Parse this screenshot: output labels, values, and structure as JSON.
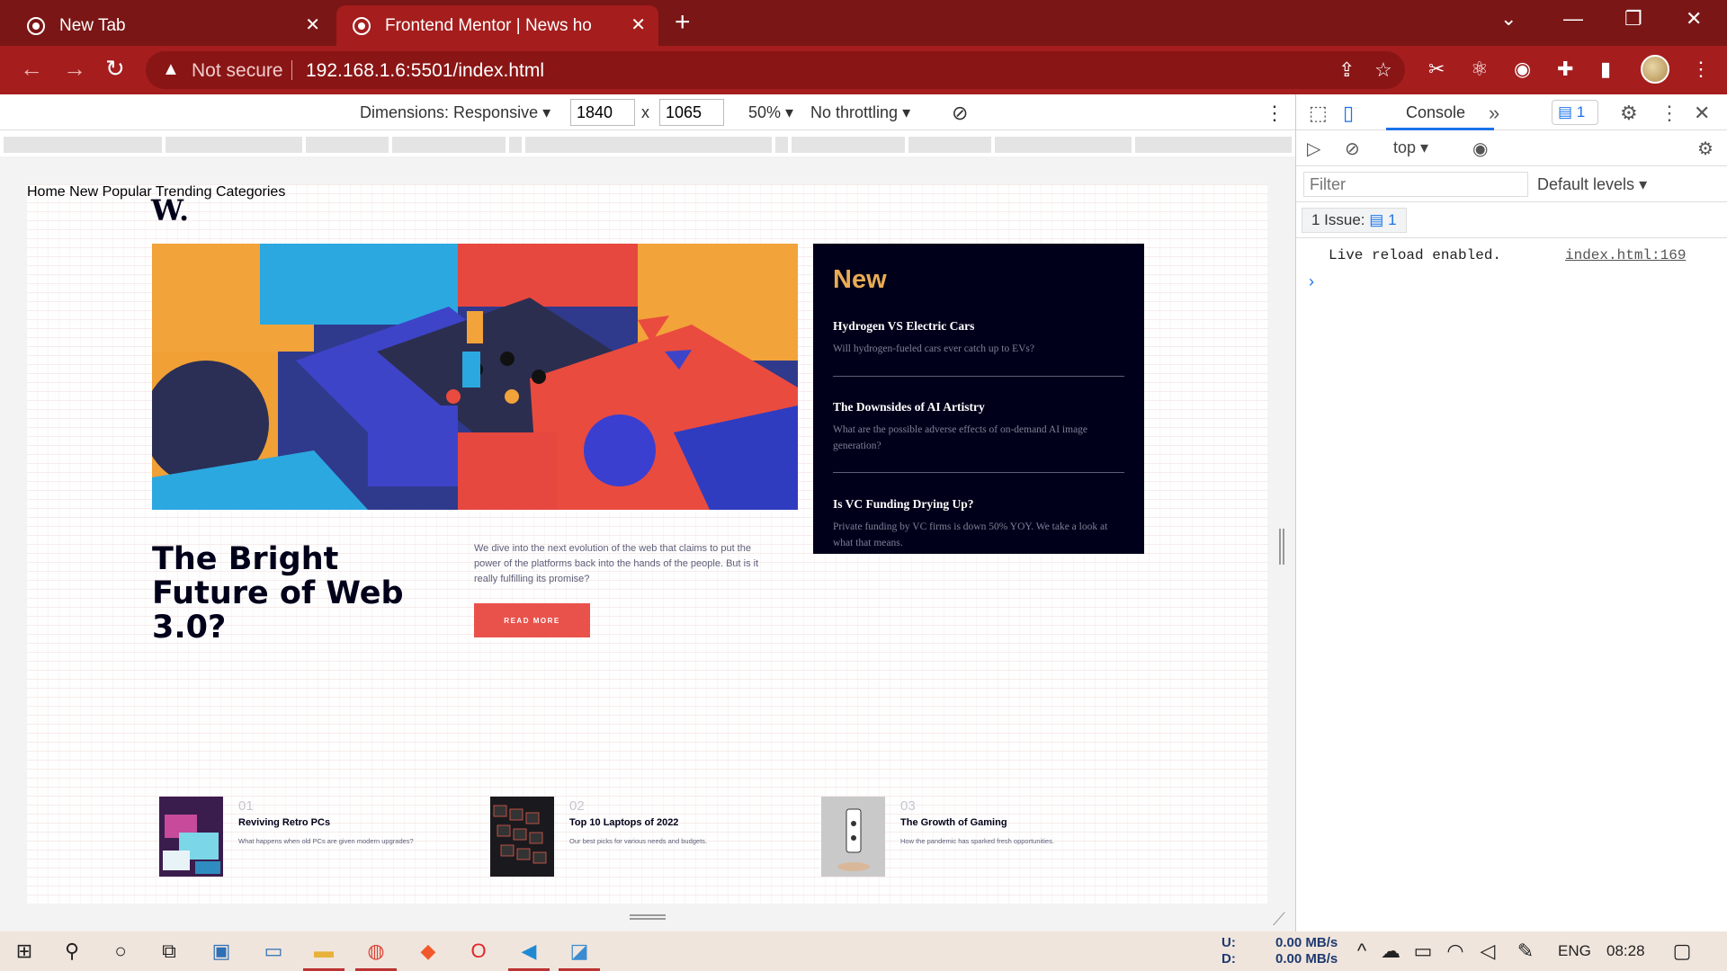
{
  "browser": {
    "tabs": [
      {
        "title": "New Tab"
      },
      {
        "title": "Frontend Mentor | News homepa"
      }
    ],
    "address": {
      "security": "Not secure",
      "url": "192.168.1.6:5501/index.html"
    }
  },
  "device_toolbar": {
    "dimensions_label": "Dimensions: Responsive",
    "width": "1840",
    "height": "1065",
    "times": "x",
    "zoom": "50%",
    "throttling": "No throttling"
  },
  "page": {
    "logo": "W.",
    "nav": [
      "Home",
      "New",
      "Popular",
      "Trending",
      "Categories"
    ],
    "hero": {
      "headline": "The Bright Future of Web 3.0?",
      "text": "We dive into the next evolution of the web that claims to put the power of the platforms back into the hands of the people. But is it really fulfilling its promise?",
      "button": "READ MORE"
    },
    "new_section": {
      "title": "New",
      "items": [
        {
          "title": "Hydrogen VS Electric Cars",
          "desc": "Will hydrogen-fueled cars ever catch up to EVs?"
        },
        {
          "title": "The Downsides of AI Artistry",
          "desc": "What are the possible adverse effects of on-demand AI image generation?"
        },
        {
          "title": "Is VC Funding Drying Up?",
          "desc": "Private funding by VC firms is down 50% YOY. We take a look at what that means."
        }
      ]
    },
    "cards": [
      {
        "num": "01",
        "title": "Reviving Retro PCs",
        "desc": "What happens when old PCs are given modern upgrades?"
      },
      {
        "num": "02",
        "title": "Top 10 Laptops of 2022",
        "desc": "Our best picks for various needs and budgets."
      },
      {
        "num": "03",
        "title": "The Growth of Gaming",
        "desc": "How the pandemic has sparked fresh opportunities."
      }
    ],
    "colors": {
      "accent_red": "#e9524b",
      "accent_orange": "#e9ab53",
      "navy": "#00001a",
      "grey": "#5d5f79"
    }
  },
  "devtools": {
    "console_tab": "Console",
    "messages_count": "1",
    "context": "top",
    "filter_placeholder": "Filter",
    "levels": "Default levels",
    "issues_label": "1 Issue:",
    "issues_count": "1",
    "log": {
      "message": "Live reload enabled.",
      "source": "index.html:169"
    },
    "prompt": "›"
  },
  "taskbar": {
    "net_up_label": "U:",
    "net_down_label": "D:",
    "net_up": "0.00 MB/s",
    "net_down": "0.00 MB/s",
    "language": "ENG",
    "time": "08:28"
  }
}
